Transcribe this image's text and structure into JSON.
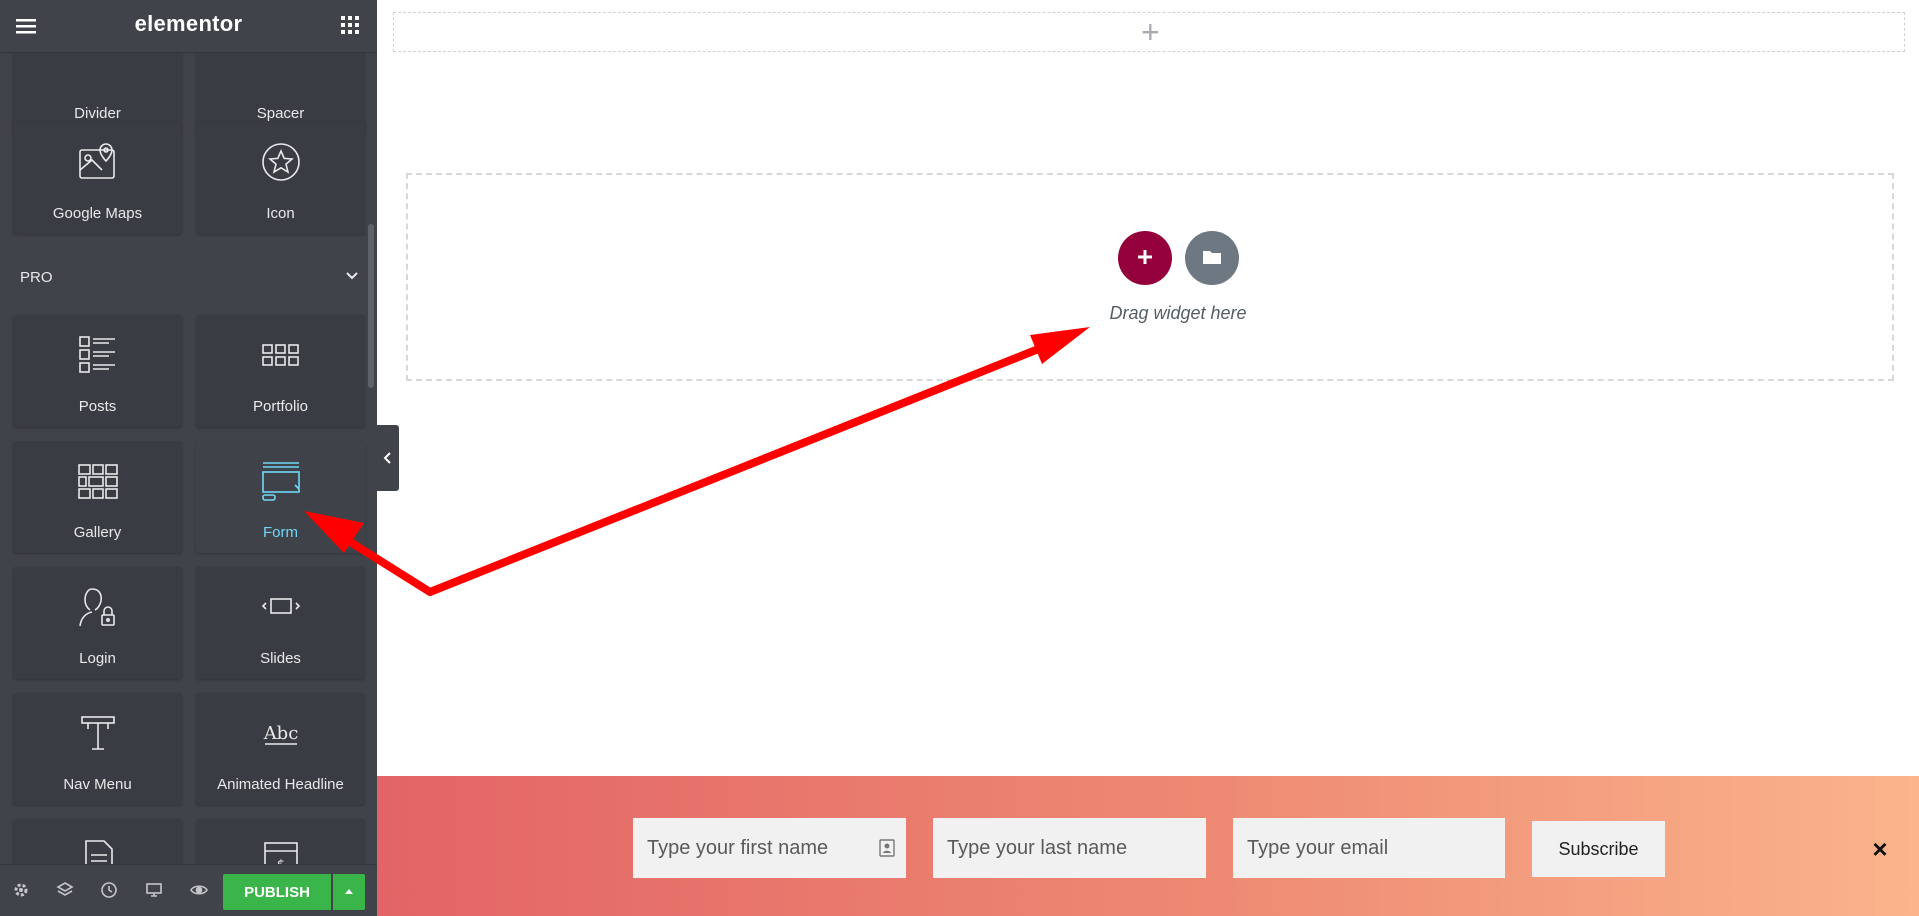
{
  "header": {
    "logo": "elementor",
    "menu_icon": "hamburger-icon",
    "apps_icon": "grid-icon"
  },
  "widgets_top": [
    {
      "label": "Divider",
      "icon": "divider-icon"
    },
    {
      "label": "Spacer",
      "icon": "spacer-icon"
    },
    {
      "label": "Google Maps",
      "icon": "map-icon"
    },
    {
      "label": "Icon",
      "icon": "star-icon"
    }
  ],
  "pro_section": {
    "label": "PRO"
  },
  "widgets_pro": [
    {
      "label": "Posts",
      "icon": "posts-icon"
    },
    {
      "label": "Portfolio",
      "icon": "portfolio-icon"
    },
    {
      "label": "Gallery",
      "icon": "gallery-icon"
    },
    {
      "label": "Form",
      "icon": "form-icon",
      "active": true
    },
    {
      "label": "Login",
      "icon": "login-icon"
    },
    {
      "label": "Slides",
      "icon": "slides-icon"
    },
    {
      "label": "Nav Menu",
      "icon": "nav-menu-icon"
    },
    {
      "label": "Animated Headline",
      "icon": "animated-headline-icon"
    }
  ],
  "footer": {
    "publish_label": "PUBLISH"
  },
  "canvas": {
    "drop_hint": "Drag widget here"
  },
  "subscribe_bar": {
    "first_name_placeholder": "Type your first name",
    "last_name_placeholder": "Type your last name",
    "email_placeholder": "Type your email",
    "button_label": "Subscribe"
  },
  "colors": {
    "panel_bg": "#404349",
    "widget_bg": "#393c42",
    "active_label": "#71d7f7",
    "add_button": "#93003c",
    "publish": "#39b54a",
    "annotation_arrow": "#ff0000"
  }
}
